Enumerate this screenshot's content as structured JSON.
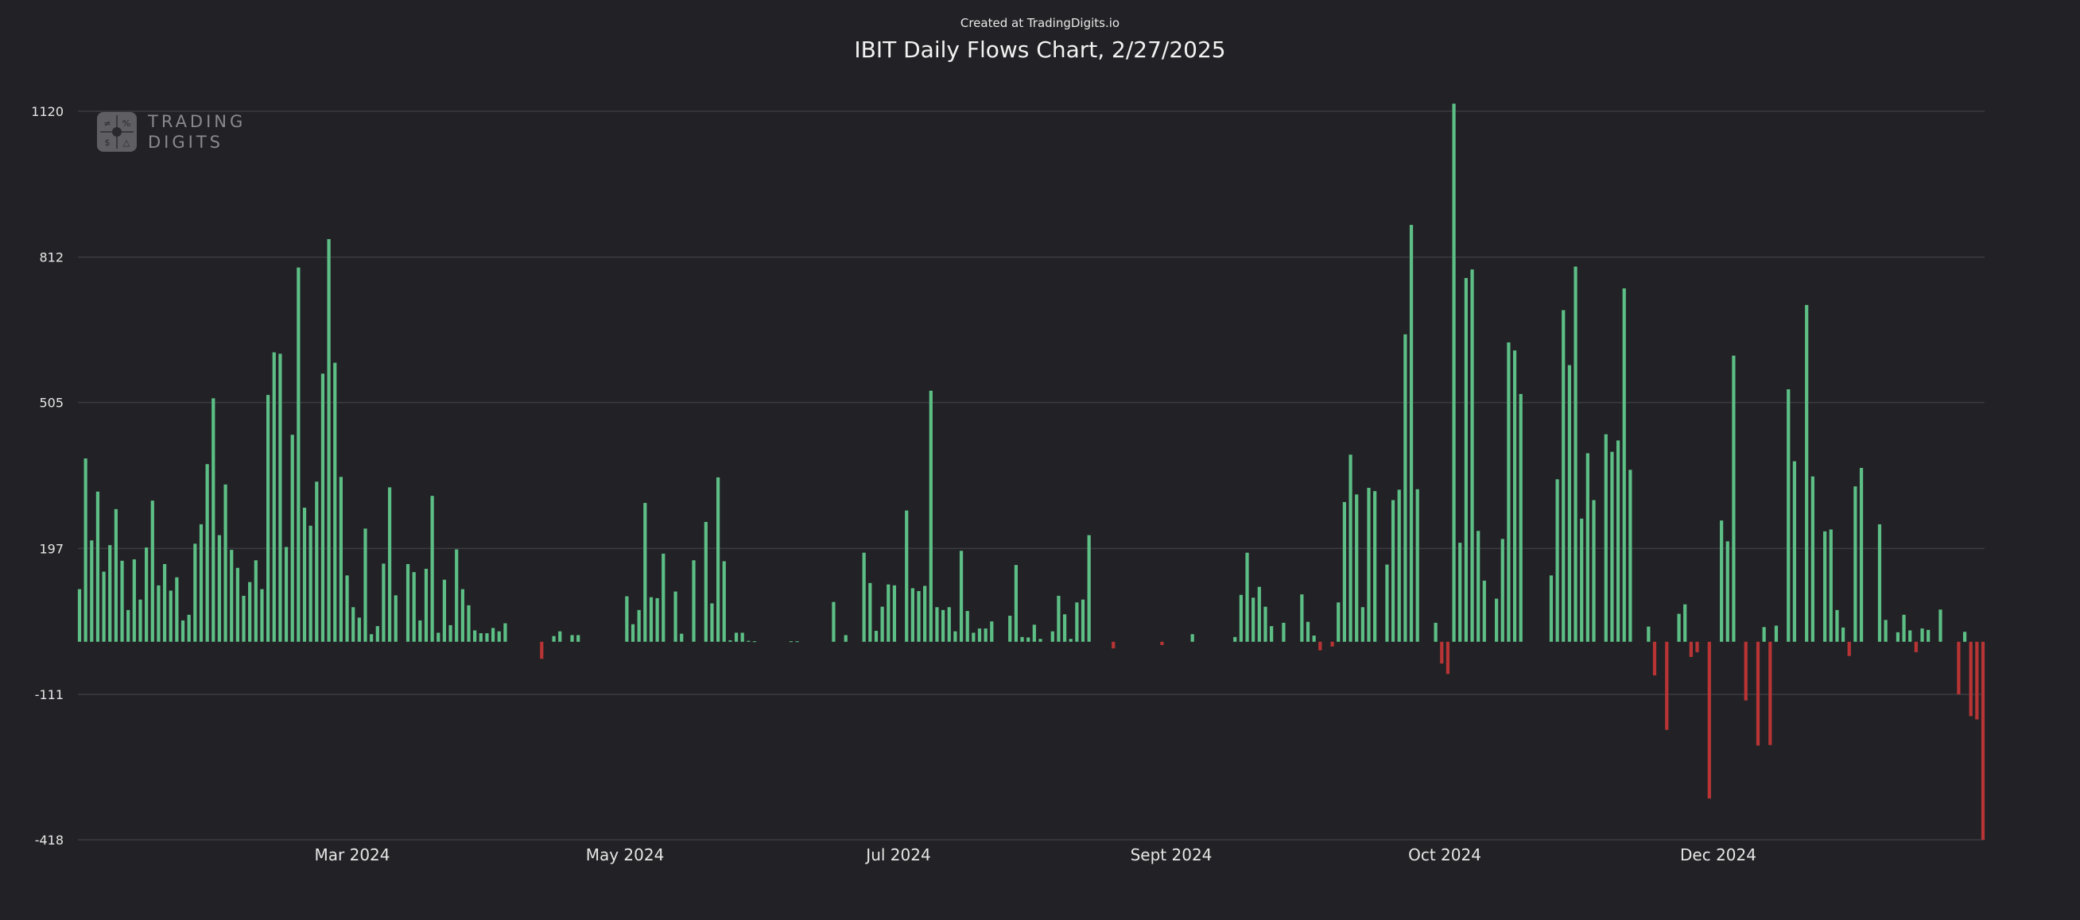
{
  "credit": "Created at TradingDigits.io",
  "chart_data": {
    "type": "bar",
    "title": "IBIT Daily Flows Chart, 2/27/2025",
    "xlabel": "",
    "ylabel": "",
    "ylim": [
      -418,
      1120
    ],
    "y_ticks": [
      1120,
      812,
      505,
      197,
      -111,
      -418
    ],
    "x_tick_labels": [
      "Mar 2024",
      "May 2024",
      "Jul 2024",
      "Sept 2024",
      "Oct 2024",
      "Dec 2024"
    ],
    "grid": true,
    "colors": {
      "positive": "#5dbf85",
      "negative": "#b93434"
    },
    "values": [
      111,
      387,
      214,
      317,
      148,
      204,
      280,
      171,
      67,
      174,
      89,
      199,
      298,
      119,
      164,
      108,
      136,
      45,
      57,
      207,
      248,
      375,
      514,
      225,
      332,
      194,
      156,
      97,
      126,
      172,
      111,
      521,
      611,
      608,
      200,
      437,
      790,
      283,
      245,
      338,
      566,
      850,
      589,
      348,
      140,
      73,
      51,
      239,
      16,
      33,
      165,
      326,
      98,
      0,
      164,
      147,
      45,
      154,
      308,
      19,
      131,
      35,
      195,
      111,
      77,
      24,
      18,
      18,
      29,
      22,
      39,
      0,
      0,
      0,
      0,
      0,
      -36,
      0,
      12,
      22,
      0,
      14,
      14,
      0,
      0,
      0,
      0,
      0,
      0,
      0,
      96,
      37,
      67,
      293,
      94,
      92,
      186,
      0,
      106,
      17,
      0,
      172,
      0,
      253,
      81,
      347,
      170,
      3,
      19,
      19,
      2,
      1,
      0,
      0,
      0,
      0,
      0,
      1,
      1,
      0,
      0,
      0,
      0,
      0,
      84,
      0,
      14,
      0,
      0,
      188,
      124,
      23,
      74,
      121,
      119,
      0,
      277,
      113,
      107,
      118,
      530,
      73,
      67,
      73,
      22,
      192,
      65,
      19,
      28,
      28,
      43,
      0,
      0,
      55,
      162,
      10,
      9,
      36,
      6,
      0,
      22,
      97,
      58,
      6,
      83,
      89,
      225,
      0,
      0,
      0,
      -14,
      0,
      0,
      0,
      0,
      0,
      0,
      0,
      -7,
      0,
      0,
      0,
      0,
      16,
      0,
      0,
      0,
      0,
      0,
      0,
      10,
      99,
      188,
      93,
      116,
      74,
      33,
      0,
      40,
      0,
      0,
      100,
      42,
      13,
      -18,
      0,
      -10,
      83,
      295,
      395,
      311,
      73,
      325,
      318,
      0,
      163,
      299,
      321,
      649,
      880,
      322,
      0,
      0,
      40,
      -46,
      -68,
      1136,
      209,
      768,
      786,
      234,
      129,
      0,
      91,
      217,
      632,
      615,
      523,
      0,
      0,
      0,
      0,
      140,
      343,
      700,
      584,
      792,
      260,
      398,
      299,
      0,
      438,
      401,
      425,
      746,
      363,
      0,
      0,
      32,
      -71,
      0,
      -186,
      0,
      59,
      79,
      -32,
      -22,
      0,
      -331,
      0,
      256,
      212,
      604,
      0,
      -124,
      0,
      -219,
      31,
      -218,
      34,
      0,
      533,
      381,
      0,
      711,
      349,
      0,
      233,
      237,
      67,
      30,
      -30,
      328,
      367,
      0,
      0,
      248,
      46,
      0,
      20,
      57,
      24,
      -22,
      28,
      25,
      0,
      68,
      0,
      0,
      -111,
      21,
      -157,
      -164,
      -418
    ]
  }
}
